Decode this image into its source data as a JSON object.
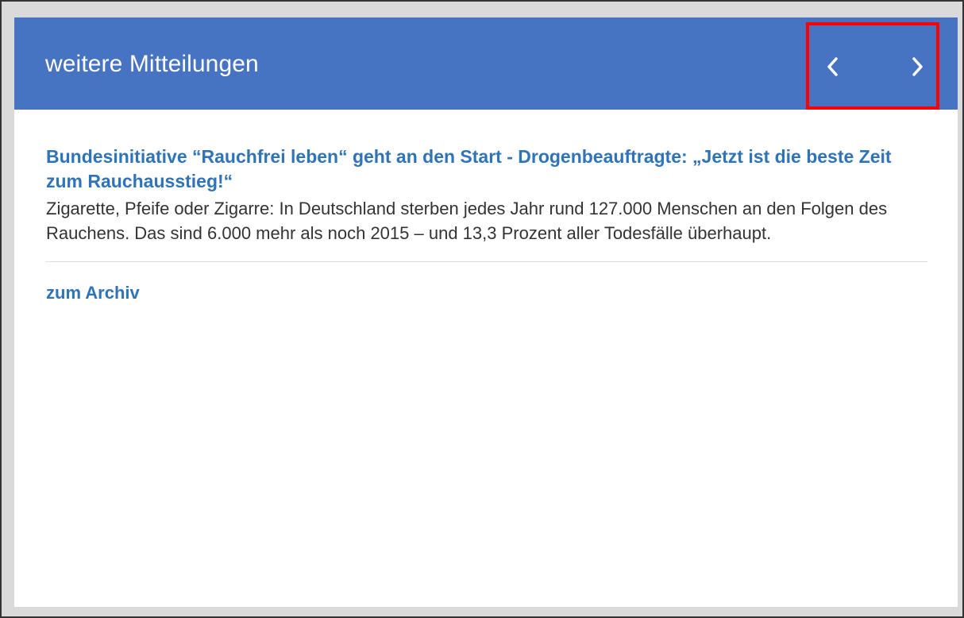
{
  "panel": {
    "title": "weitere Mitteilungen",
    "nav": {
      "prev_icon": "chevron-left-icon",
      "next_icon": "chevron-right-icon"
    }
  },
  "news": {
    "title": "Bundesinitiative “Rauchfrei leben“ geht an den Start - Drogenbeauftragte: „Jetzt ist die beste Zeit zum Rauchausstieg!“",
    "text": "Zigarette, Pfeife oder Zigarre: In Deutschland sterben jedes Jahr rund 127.000 Menschen an den Folgen des Rauchens. Das sind 6.000 mehr als noch 2015 – und 13,3 Prozent aller Todesfälle überhaupt."
  },
  "archive_label": "zum Archiv",
  "colors": {
    "header_bg": "#4674c3",
    "link": "#2f73b8",
    "highlight": "#ff0000"
  }
}
